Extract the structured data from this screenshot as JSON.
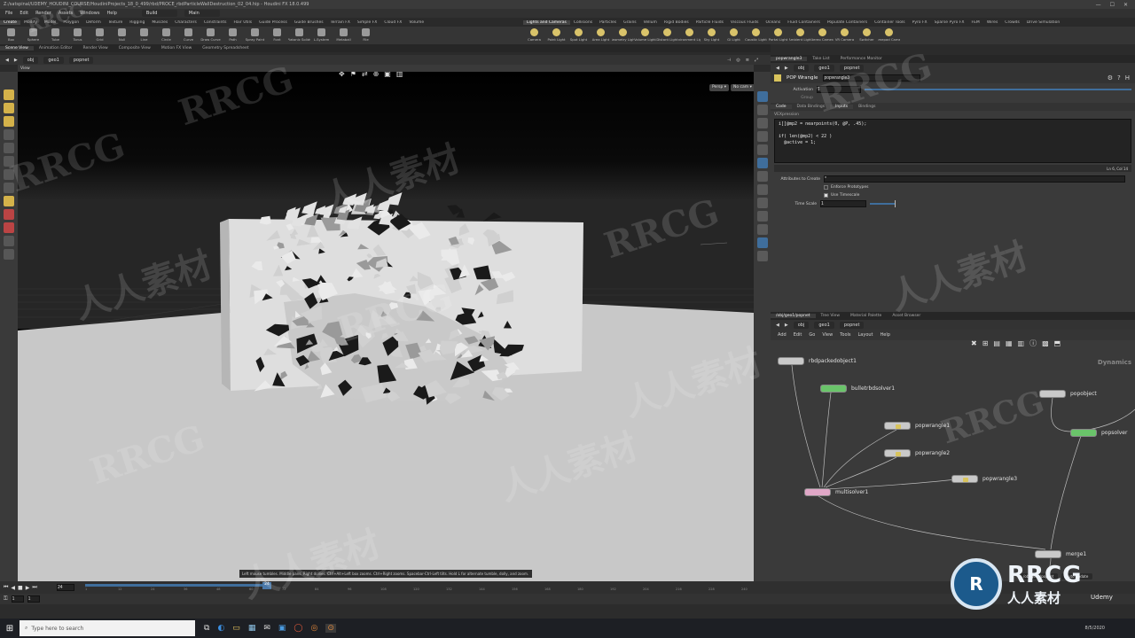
{
  "window": {
    "title": "Z:/satspinal/UDEMY_HOUDINI_COURSE/HoudiniProjects_18_0_499/rbd/PROCE_rbdParticleWallDestruction_02_04.hip - Houdini FX 18.0.499",
    "minimize": "—",
    "maximize": "☐",
    "close": "✕"
  },
  "menubar": {
    "items": [
      "File",
      "Edit",
      "Render",
      "Assets",
      "Windows",
      "Help"
    ],
    "desktop_selector": "Build",
    "context_selector": "Main"
  },
  "shelf_tabs_left": [
    "Create",
    "Modify",
    "Model",
    "Polygon",
    "Deform",
    "Texture",
    "Rigging",
    "Muscles",
    "Characters",
    "Constraints",
    "Hair Utils",
    "Guide Process",
    "Guide Brushes",
    "Terrain FX",
    "Simple FX",
    "Cloud FX",
    "Volume"
  ],
  "shelf_tabs_right": [
    "Lights and Cameras",
    "Collisions",
    "Particles",
    "Grains",
    "Vellum",
    "Rigid Bodies",
    "Particle Fluids",
    "Viscous Fluids",
    "Oceans",
    "Fluid Containers",
    "Populate Containers",
    "Container Tools",
    "Pyro FX",
    "Sparse Pyro FX",
    "FEM",
    "Wires",
    "Crowds",
    "Drive Simulation"
  ],
  "shelf_tools_left": [
    "Box",
    "Sphere",
    "Tube",
    "Torus",
    "Grid",
    "Null",
    "Line",
    "Circle",
    "Curve",
    "Draw Curve",
    "Path",
    "Spray Paint",
    "Font",
    "Platonic Solids",
    "L-System",
    "Metaball",
    "File"
  ],
  "shelf_tools_right": [
    "Camera",
    "Point Light",
    "Spot Light",
    "Area Light",
    "Geometry Light",
    "Volume Light",
    "Distant Light",
    "Environment Light",
    "Sky Light",
    "GI Light",
    "Caustic Light",
    "Portal Light",
    "Ambient Light",
    "Stereo Camera",
    "VR Camera",
    "Switcher",
    "Gamepad Camera"
  ],
  "viewer_tabs": [
    "Scene View",
    "Animation Editor",
    "Render View",
    "Composite View",
    "Motion FX View",
    "Geometry Spreadsheet"
  ],
  "path": {
    "root": "obj",
    "geo": "geo1",
    "node": "popnet"
  },
  "viewport": {
    "label": "View",
    "persp_button": "Persp ▾",
    "cam_button": "No cam ▾",
    "status_hint": "Left mouse tumbles. Middle pans. Right dollies. Ctrl+Alt+Left box zooms. Ctrl+Right zooms. Spacebar-Ctrl-Left tilts. Hold L for alternate tumble, dolly, and zoom."
  },
  "param_panel": {
    "tabs": [
      "popwrangle3",
      "Take List",
      "Performance Monitor"
    ],
    "path": {
      "root": "obj",
      "geo": "geo1",
      "node": "popnet"
    },
    "node_type": "POP Wrangle",
    "node_name": "popwrangle3",
    "activation_label": "Activation",
    "activation_value": "1",
    "group_label": "Group",
    "subtabs": [
      "Code",
      "Data Bindings",
      "Inputs",
      "Bindings"
    ],
    "vex_label": "VEXpression",
    "code_lines": [
      "i[]@mp2 = nearpoints(0, @P, .45);",
      "",
      "if( len(@mp2) < 22 )",
      "  @active = 1;"
    ],
    "cursor": "Ln 6, Col 14",
    "attributes_label": "Attributes to Create",
    "attributes_value": "*",
    "enforce_label": "Enforce Prototypes",
    "use_timescale_label": "Use Timescale",
    "timescale_label": "Time Scale",
    "timescale_value": "1"
  },
  "network": {
    "tabs": [
      "/obj/geo1/popnet",
      "Tree View",
      "Material Palette",
      "Asset Browser"
    ],
    "path": {
      "root": "obj",
      "geo": "geo1",
      "node": "popnet"
    },
    "menu": [
      "Add",
      "Edit",
      "Go",
      "View",
      "Tools",
      "Layout",
      "Help"
    ],
    "context_label": "Dynamics",
    "nodes": {
      "rbdpacked": "rbdpackedobject1",
      "bullet": "bulletrbdsolver1",
      "popobject": "popobject",
      "popwrangle1": "popwrangle1",
      "popwrangle2": "popwrangle2",
      "popwrangle3": "popwrangle3",
      "popsolver": "popsolver",
      "multisolver": "multisolver1",
      "merge": "merge1"
    },
    "status_path": "/obj/geo1/popnet",
    "update_label": "Auto Update"
  },
  "timeline": {
    "frame": "24",
    "start": "1",
    "end": "1",
    "ticks": [
      "1",
      "12",
      "24",
      "36",
      "48",
      "60",
      "72",
      "84",
      "96",
      "108",
      "120",
      "132",
      "144",
      "156",
      "168",
      "180",
      "192",
      "204",
      "216",
      "228",
      "240"
    ]
  },
  "taskbar": {
    "search_placeholder": "Type here to search",
    "date": "8/5/2020"
  },
  "watermarks": [
    "RRCG",
    "人人素材"
  ],
  "logo": {
    "brand": "RRCG",
    "tagline": "人人素材",
    "udemy": "Udemy"
  },
  "colors": {
    "accent": "#3f6e9c",
    "node_green": "#6ac46a",
    "node_pink": "#e0a7c7"
  }
}
